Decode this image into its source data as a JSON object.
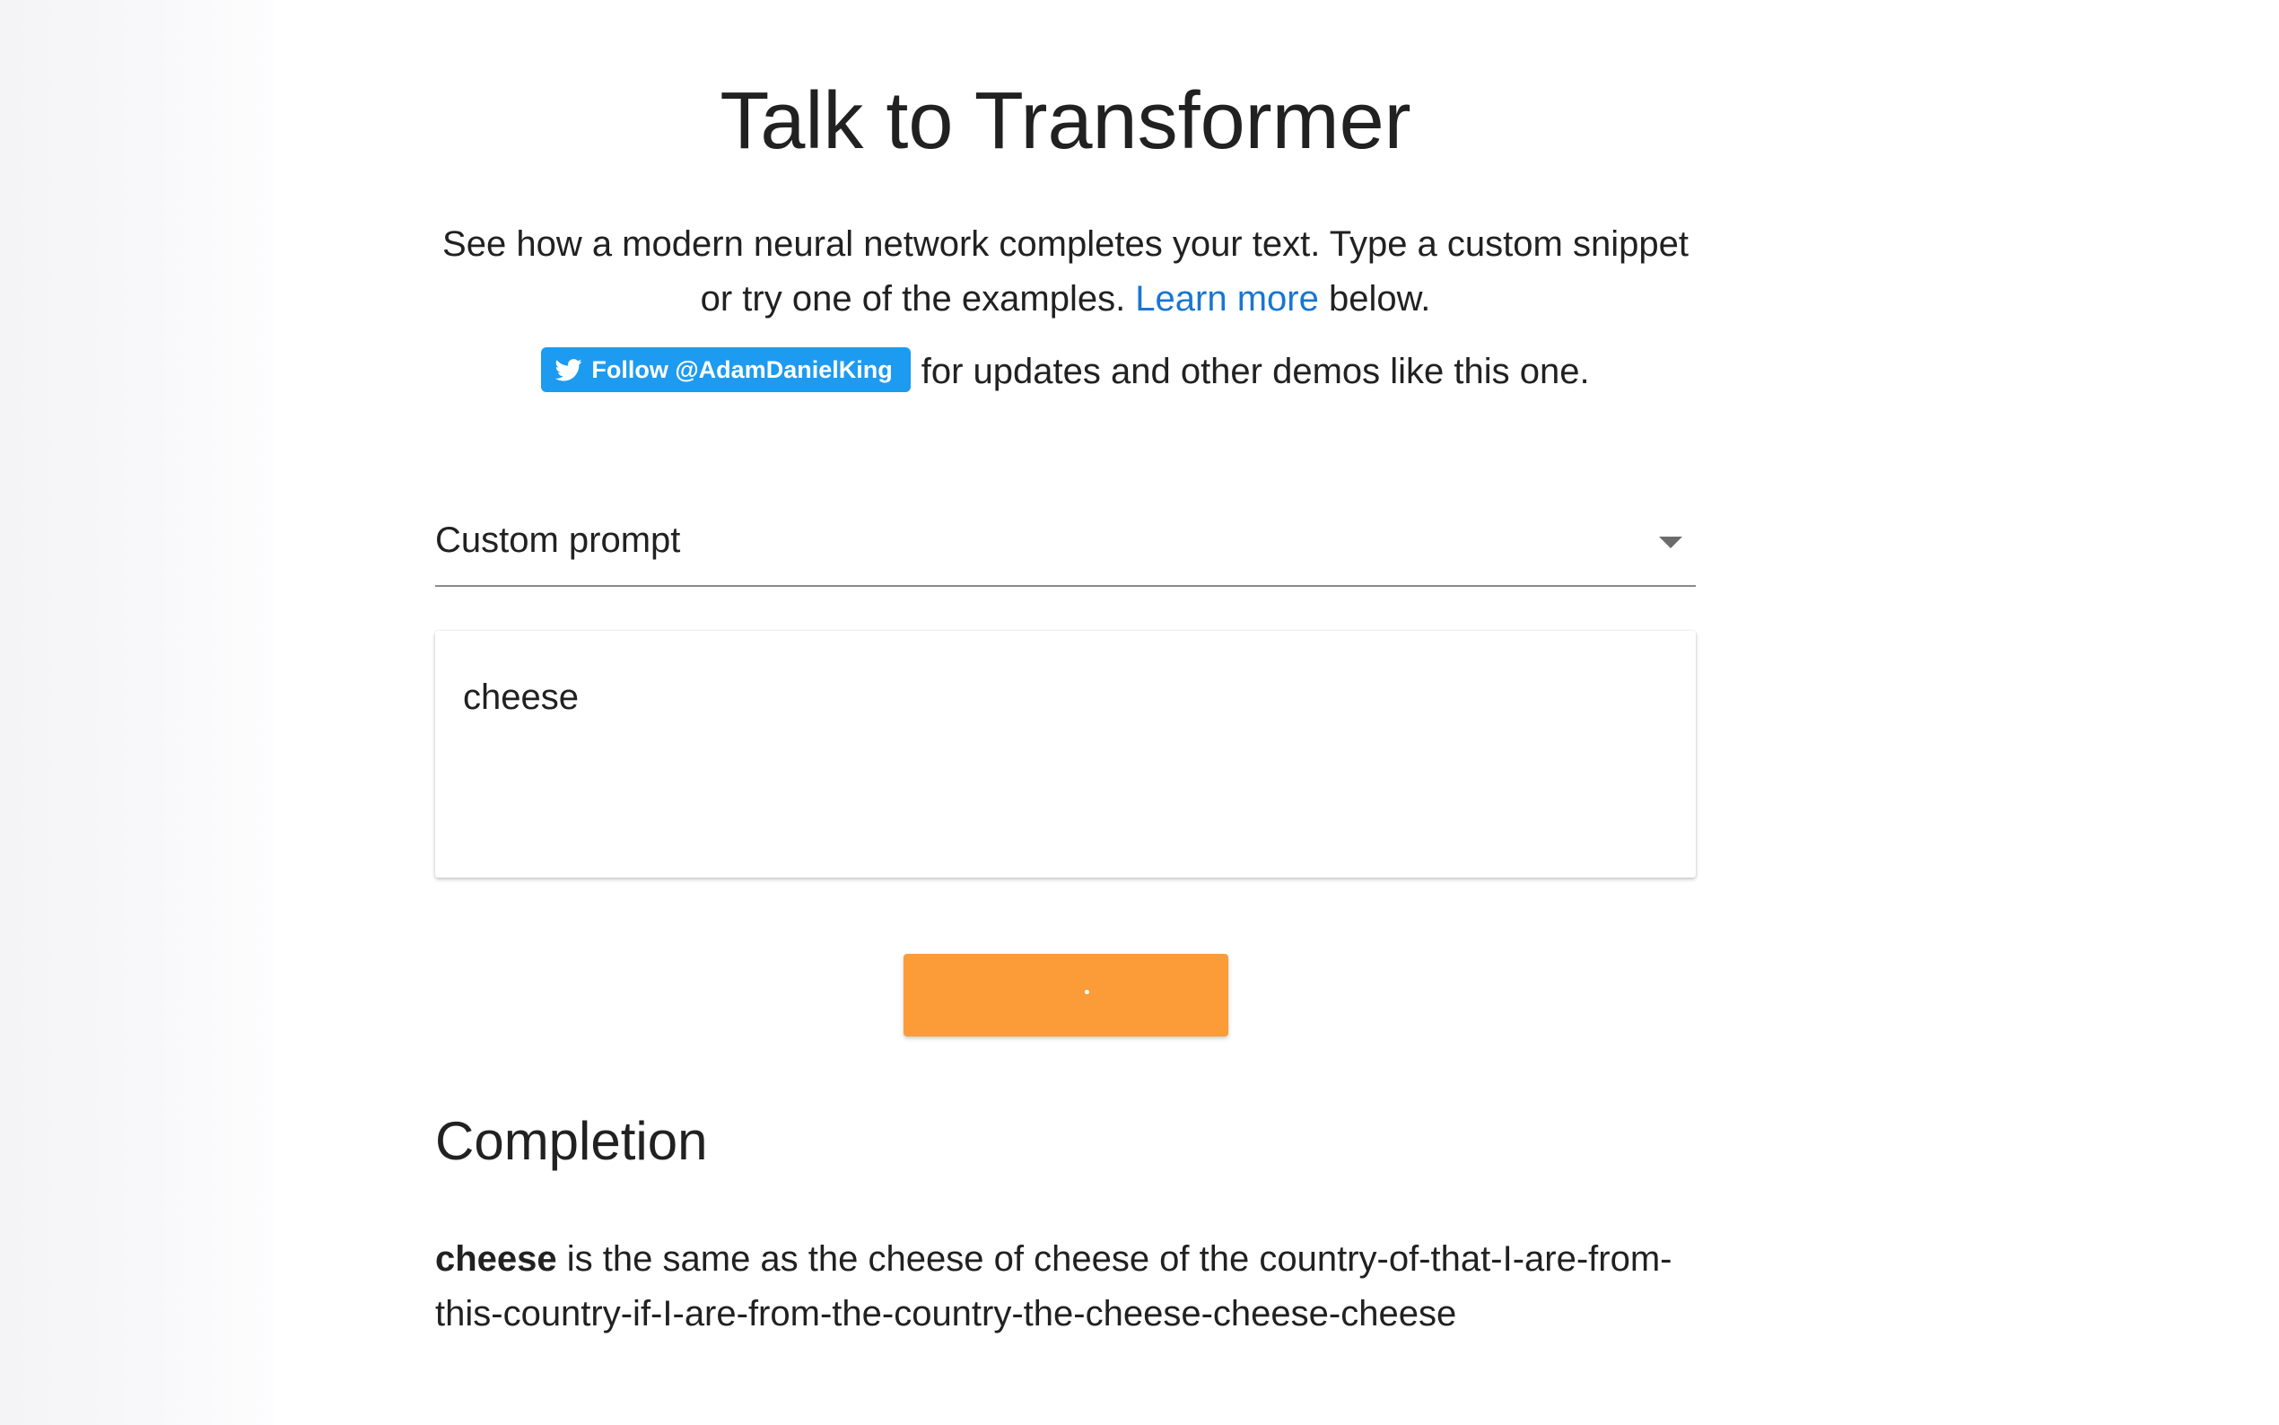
{
  "header": {
    "title": "Talk to Transformer"
  },
  "intro": {
    "text_before_link": "See how a modern neural network completes your text. Type a custom snippet or try one of the examples. ",
    "link_label": "Learn more",
    "text_after_link": " below."
  },
  "follow": {
    "button_label": "Follow @AdamDanielKing",
    "trailing_text": "for updates and other demos like this one.",
    "icon": "twitter-bird-icon",
    "button_color": "#1d9bf0"
  },
  "prompt_select": {
    "selected_value": "Custom prompt",
    "icon": "chevron-down-icon"
  },
  "prompt_input": {
    "value": "cheese"
  },
  "generate_button": {
    "state": "loading",
    "color": "#fb9c39"
  },
  "completion": {
    "heading": "Completion",
    "prompt_bold": "cheese",
    "generated_text": " is the same as the cheese of cheese of the country-of-that-I-are-from-this-country-if-I-are-from-the-country-the-cheese-cheese-cheese"
  },
  "colors": {
    "link": "#1976d2",
    "text": "#212121"
  }
}
